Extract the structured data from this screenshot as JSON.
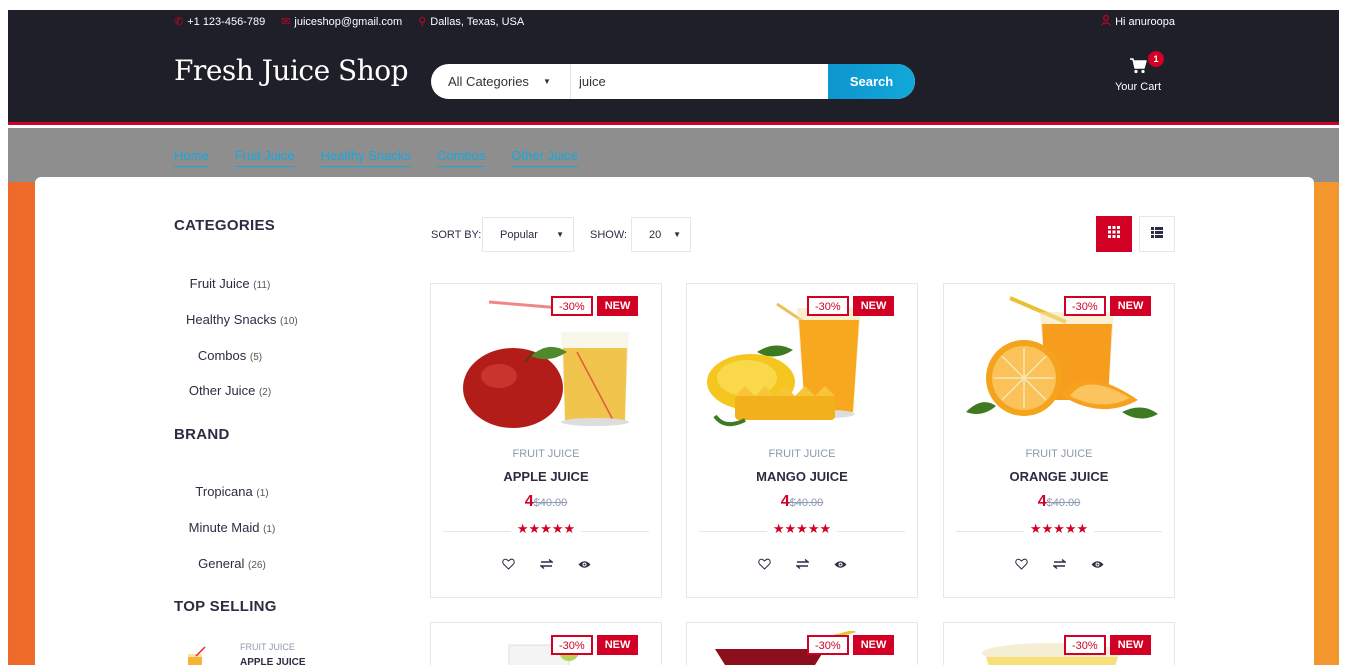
{
  "top_strip": {
    "phone": "+1 123-456-789",
    "email": "juiceshop@gmail.com",
    "location": "Dallas, Texas, USA",
    "account": "Hi anuroopa"
  },
  "header": {
    "logo": "Fresh Juice Shop",
    "search": {
      "category": "All Categories",
      "query": "juice",
      "button": "Search"
    },
    "cart": {
      "label": "Your Cart",
      "qty": "1"
    }
  },
  "nav": [
    "Home",
    "Fruit Juice",
    "Healthy Snacks",
    "Combos",
    "Other Juice"
  ],
  "sidebar": {
    "categories_title": "CATEGORIES",
    "categories": [
      {
        "label": "Fruit Juice",
        "count": "(11)"
      },
      {
        "label": "Healthy Snacks",
        "count": "(10)"
      },
      {
        "label": "Combos",
        "count": "(5)"
      },
      {
        "label": "Other Juice",
        "count": "(2)"
      }
    ],
    "brand_title": "BRAND",
    "brands": [
      {
        "label": "Tropicana",
        "count": "(1)"
      },
      {
        "label": "Minute Maid",
        "count": "(1)"
      },
      {
        "label": "General",
        "count": "(26)"
      }
    ],
    "top_selling_title": "TOP SELLING",
    "top_selling": {
      "category": "FRUIT JUICE",
      "name": "APPLE JUICE"
    }
  },
  "filter": {
    "sort_label": "SORT BY:",
    "sort_value": "Popular",
    "show_label": "SHOW:",
    "show_value": "20"
  },
  "products": [
    {
      "category": "FRUIT JUICE",
      "name": "APPLE JUICE",
      "price": "4",
      "old_price": "$40.00",
      "sale": "-30%",
      "new": "NEW",
      "rating": 5
    },
    {
      "category": "FRUIT JUICE",
      "name": "MANGO JUICE",
      "price": "4",
      "old_price": "$40.00",
      "sale": "-30%",
      "new": "NEW",
      "rating": 5
    },
    {
      "category": "FRUIT JUICE",
      "name": "ORANGE JUICE",
      "price": "4",
      "old_price": "$40.00",
      "sale": "-30%",
      "new": "NEW",
      "rating": 5
    },
    {
      "sale": "-30%",
      "new": "NEW"
    },
    {
      "sale": "-30%",
      "new": "NEW"
    },
    {
      "sale": "-30%",
      "new": "NEW"
    }
  ],
  "colors": {
    "primary": "#d10024",
    "header_bg": "#1e1f29",
    "nav_bg": "#8e8e8e",
    "search_button": "#0f9bd6",
    "nav_link": "#16a8de"
  }
}
